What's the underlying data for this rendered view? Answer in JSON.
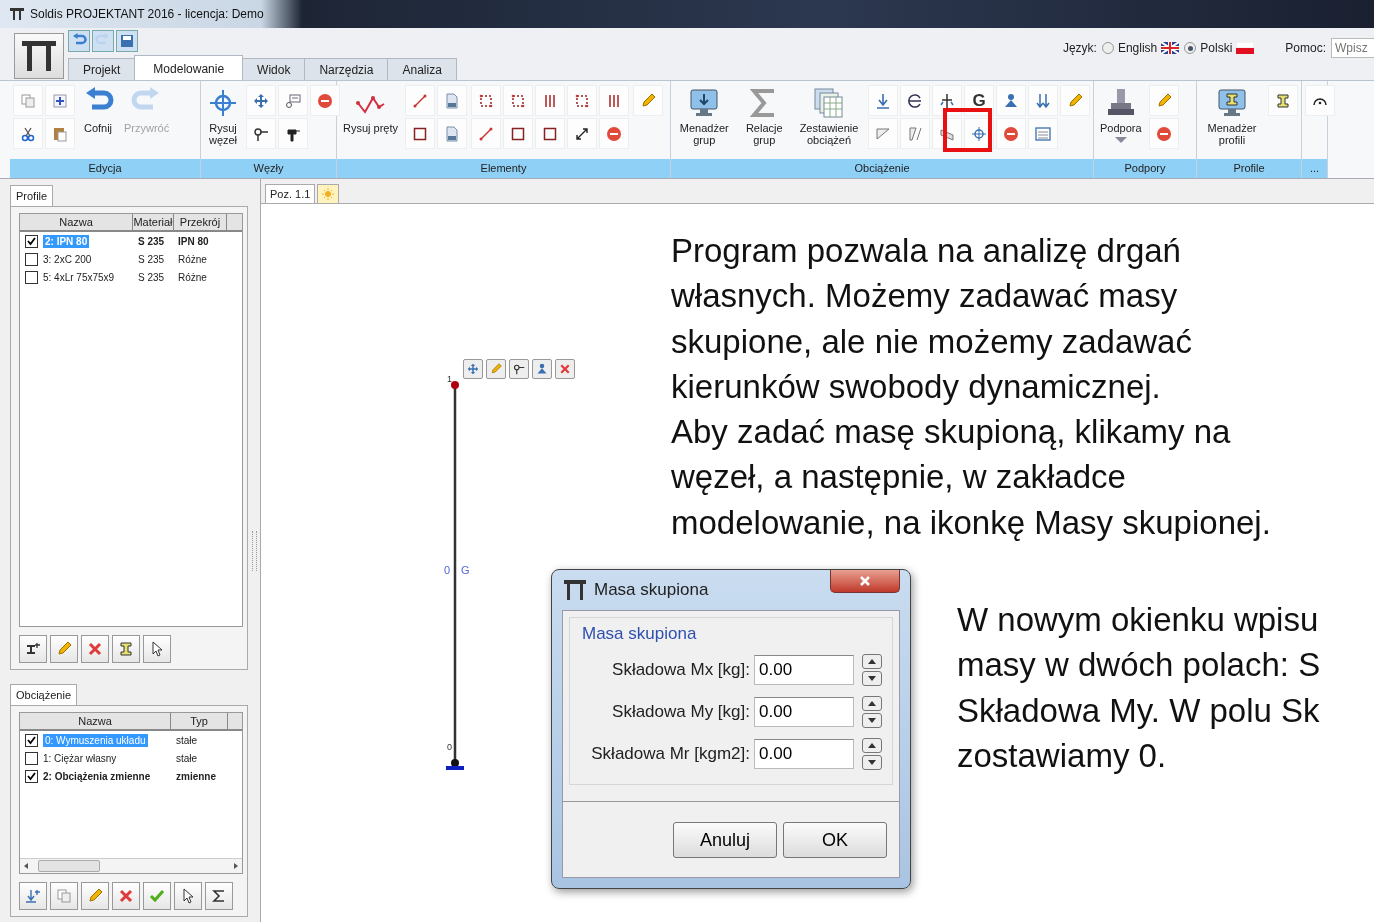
{
  "window": {
    "title": "Soldis PROJEKTANT 2016 - licencja: Demo"
  },
  "menu_tabs": [
    {
      "label": "Projekt",
      "selected": false
    },
    {
      "label": "Modelowanie",
      "selected": true
    },
    {
      "label": "Widok",
      "selected": false
    },
    {
      "label": "Narzędzia",
      "selected": false
    },
    {
      "label": "Analiza",
      "selected": false
    }
  ],
  "language": {
    "label": "Język:",
    "options": [
      {
        "label": "English",
        "selected": false
      },
      {
        "label": "Polski",
        "selected": true
      }
    ]
  },
  "help": {
    "label": "Pomoc:",
    "placeholder": "Wpisz"
  },
  "ribbon": {
    "groups": [
      {
        "label": "Edycja",
        "buttons": [
          {
            "label": "Cofnij",
            "disabled": false
          },
          {
            "label": "Przywróć",
            "disabled": true
          }
        ]
      },
      {
        "label": "Węzły",
        "buttons": [
          {
            "label": "Rysuj węzeł",
            "disabled": false
          }
        ]
      },
      {
        "label": "Elementy",
        "buttons": [
          {
            "label": "Rysuj pręty",
            "disabled": false
          }
        ]
      },
      {
        "label": "Obciążenie",
        "glyph": "G",
        "buttons": [
          {
            "label": "Menadżer grup",
            "disabled": false
          },
          {
            "label": "Relacje grup",
            "disabled": false
          },
          {
            "label": "Zestawienie obciążeń",
            "disabled": false
          }
        ]
      },
      {
        "label": "Podpory",
        "buttons": [
          {
            "label": "Podpora",
            "disabled": false
          }
        ]
      },
      {
        "label": "Profile",
        "buttons": [
          {
            "label": "Menadżer profili",
            "disabled": false
          }
        ]
      },
      {
        "label": "..."
      }
    ]
  },
  "profiles_panel": {
    "tab": "Profile",
    "columns": [
      "Nazwa",
      "Materiał",
      "Przekrój"
    ],
    "rows": [
      {
        "cells": [
          "2: IPN 80",
          "S 235",
          "IPN 80"
        ],
        "checked": true,
        "selected": true,
        "bold": true
      },
      {
        "cells": [
          "3: 2xC 200",
          "S 235",
          "Różne"
        ],
        "checked": false,
        "selected": false,
        "bold": false
      },
      {
        "cells": [
          "5: 4xLr 75x75x9",
          "S 235",
          "Różne"
        ],
        "checked": false,
        "selected": false,
        "bold": false
      }
    ]
  },
  "loads_panel": {
    "tab": "Obciążenie",
    "columns": [
      "Nazwa",
      "Typ"
    ],
    "rows": [
      {
        "cells": [
          "0: Wymuszenia układu",
          "stałe"
        ],
        "checked": true,
        "selected": true,
        "bold": false
      },
      {
        "cells": [
          "1: Ciężar własny",
          "stałe"
        ],
        "checked": false,
        "selected": false,
        "bold": false
      },
      {
        "cells": [
          "2: Obciążenia zmienne",
          "zmienne"
        ],
        "checked": true,
        "selected": false,
        "bold": true
      }
    ]
  },
  "document_tab": {
    "label": "Poz. 1.1"
  },
  "structure": {
    "top_node": "1",
    "bottom_node": "0",
    "bar_number": "0",
    "bar_profile": "G"
  },
  "dialog": {
    "title": "Masa skupiona",
    "group": "Masa skupiona",
    "fields": [
      {
        "label": "Składowa Mx [kg]:",
        "value": "0.00"
      },
      {
        "label": "Składowa My [kg]:",
        "value": "0.00"
      },
      {
        "label": "Składowa Mr [kgm2]:",
        "value": "0.00"
      }
    ],
    "buttons": [
      "Anuluj",
      "OK"
    ]
  },
  "annotations": [
    {
      "lines": [
        "Program pozwala na analizę drgań",
        "własnych. Możemy zadawać masy",
        "skupione, ale nie możemy zadawać",
        "kierunków swobody dynamicznej.",
        "Aby zadać masę skupioną, klikamy na",
        "węzeł, a następnie, w zakładce",
        "modelowanie, na ikonkę Masy skupionej."
      ]
    },
    {
      "lines": [
        "W nowym okienku wpisu",
        "masy w dwóch polach: S",
        "Składowa My. W polu Sk",
        "zostawiamy 0."
      ]
    }
  ]
}
